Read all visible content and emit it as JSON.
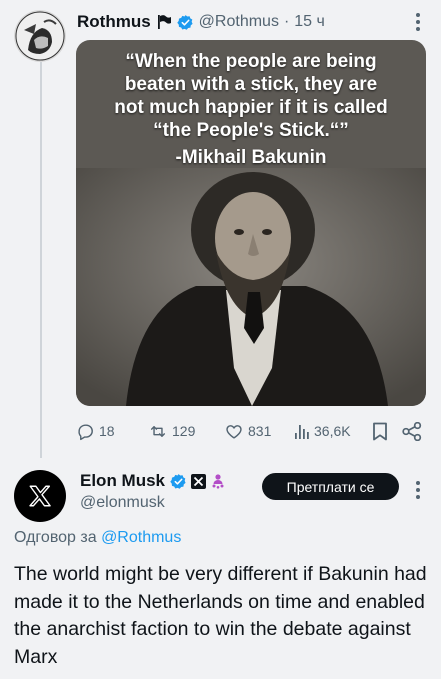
{
  "post": {
    "author_name": "Rothmus",
    "author_handle": "@Rothmus",
    "time_separator": "·",
    "time": "15 ч",
    "quote_lines": [
      "“When the people are being",
      "beaten with a stick, they are",
      "not much happier if it is called",
      "“the People's Stick.“”"
    ],
    "quote_attribution": "-Mikhail Bakunin",
    "stats": {
      "replies": "18",
      "reposts": "129",
      "likes": "831",
      "views": "36,6K"
    }
  },
  "reply": {
    "author_name": "Elon Musk",
    "author_handle": "@elonmusk",
    "subscribe_label": "Претплати се",
    "reply_to_prefix": "Одговор за",
    "reply_to_mention": "@Rothmus",
    "text": "The world might be very different if Bakunin had made it to the Netherlands on time and enabled the anarchist faction to win the debate against Marx"
  },
  "colors": {
    "accent": "#1d9bf0",
    "text": "#0f1419",
    "muted": "#536471",
    "background": "#f1f2f4"
  },
  "icons": [
    "avatar-rothmus",
    "flag-icon",
    "verified-badge-icon",
    "more-icon",
    "reply-icon",
    "repost-icon",
    "like-icon",
    "views-icon",
    "bookmark-icon",
    "share-icon",
    "x-logo-icon",
    "affiliate-badge-icon"
  ]
}
